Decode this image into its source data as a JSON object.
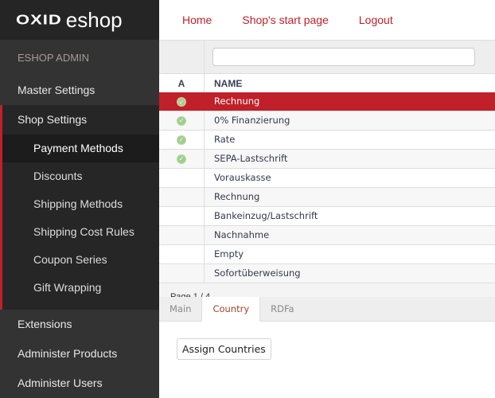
{
  "logo": {
    "brand": "OXID",
    "product": "eshop"
  },
  "sidebar": {
    "title": "ESHOP ADMIN",
    "items_before": [
      {
        "label": "Master Settings"
      }
    ],
    "group": {
      "label": "Shop Settings",
      "subitems": [
        {
          "label": "Payment Methods",
          "active": true
        },
        {
          "label": "Discounts"
        },
        {
          "label": "Shipping Methods"
        },
        {
          "label": "Shipping Cost Rules"
        },
        {
          "label": "Coupon Series"
        },
        {
          "label": "Gift Wrapping"
        }
      ]
    },
    "items_after": [
      {
        "label": "Extensions"
      },
      {
        "label": "Administer Products"
      },
      {
        "label": "Administer Users"
      }
    ]
  },
  "topnav": {
    "home": "Home",
    "start_page": "Shop's start page",
    "logout": "Logout"
  },
  "list": {
    "filter_value": "",
    "columns": {
      "active": "A",
      "name": "NAME"
    },
    "rows": [
      {
        "active": true,
        "name": "Rechnung",
        "selected": true
      },
      {
        "active": true,
        "name": "0% Finanzierung"
      },
      {
        "active": true,
        "name": "Rate"
      },
      {
        "active": true,
        "name": "SEPA-Lastschrift"
      },
      {
        "active": false,
        "name": "Vorauskasse"
      },
      {
        "active": false,
        "name": "Rechnung"
      },
      {
        "active": false,
        "name": "Bankeinzug/Lastschrift"
      },
      {
        "active": false,
        "name": "Nachnahme"
      },
      {
        "active": false,
        "name": "Empty"
      },
      {
        "active": false,
        "name": "Sofortüberweisung"
      }
    ],
    "paging": "Page 1 / 4"
  },
  "tabs": [
    {
      "label": "Main"
    },
    {
      "label": "Country",
      "active": true
    },
    {
      "label": "RDFa"
    }
  ],
  "content": {
    "assign_button": "Assign Countries"
  },
  "colors": {
    "accent": "#c0202a",
    "sidebar_bg": "#333333",
    "check_green": "#9fce8d"
  }
}
